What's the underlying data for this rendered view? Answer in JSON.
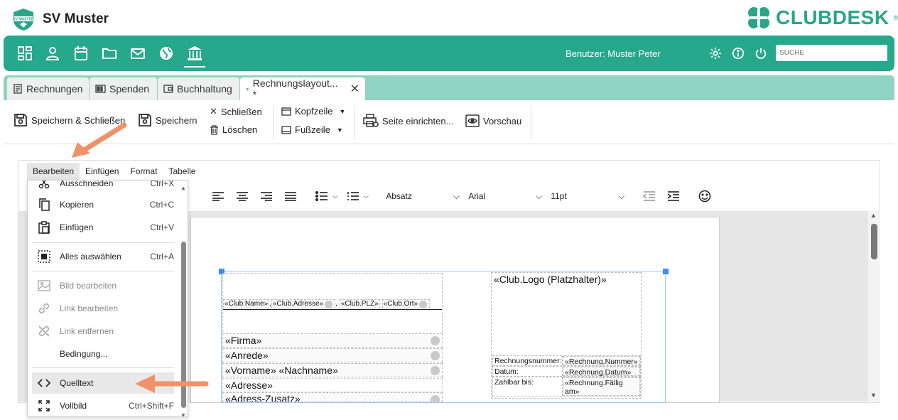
{
  "app": {
    "club_name": "SV Muster",
    "badge_text": "SV MUSTER",
    "brand": "CLUBDESK",
    "brand_mark": "®"
  },
  "nav": {
    "user_label": "Benutzer: Muster Peter",
    "search_placeholder": "SUCHE",
    "icons": [
      "dashboard-icon",
      "person-icon",
      "calendar-icon",
      "folder-icon",
      "mail-icon",
      "globe-icon",
      "bank-icon"
    ]
  },
  "tabs": [
    {
      "label": "Rechnungen",
      "icon": "invoice-icon"
    },
    {
      "label": "Spenden",
      "icon": "donation-icon"
    },
    {
      "label": "Buchhaltung",
      "icon": "ledger-icon"
    },
    {
      "label": "Rechnungslayout... *",
      "icon": "book-icon",
      "active": true
    }
  ],
  "toolbar": {
    "save_close": "Speichern & Schließen",
    "save": "Speichern",
    "close": "Schließen",
    "delete": "Löschen",
    "header": "Kopfzeile",
    "footer": "Fußzeile",
    "page_setup": "Seite einrichten...",
    "preview": "Vorschau"
  },
  "editor": {
    "menu": [
      "Bearbeiten",
      "Einfügen",
      "Format",
      "Tabelle"
    ],
    "block_format": "Absatz",
    "font": "Arial",
    "size": "11pt"
  },
  "document": {
    "sender_line": [
      "«Club.Name»",
      "«Club.Adresse»",
      "«Club.PLZ»",
      "«Club.Ort»"
    ],
    "address_fields": [
      "«Firma»",
      "«Anrede»",
      "«Vorname» «Nachname»",
      "«Adresse»",
      "«Adress-Zusatz»"
    ],
    "logo": "«Club.Logo (Platzhalter)»",
    "info_table": [
      {
        "label": "Rechnungsnummer:",
        "value": "«Rechnung.Nummer»"
      },
      {
        "label": "Datum:",
        "value": "«Rechnung.Datum»"
      },
      {
        "label": "Zahlbar bis:",
        "value": "«Rechnung.Fällig am»"
      }
    ]
  },
  "dropdown": {
    "items": [
      {
        "label": "Ausschneiden",
        "shortcut": "Ctrl+X",
        "icon": "scissors-icon",
        "disabled": false
      },
      {
        "label": "Kopieren",
        "shortcut": "Ctrl+C",
        "icon": "copy-icon",
        "disabled": false
      },
      {
        "label": "Einfügen",
        "shortcut": "Ctrl+V",
        "icon": "paste-icon",
        "disabled": false
      },
      {
        "label": "Alles auswählen",
        "shortcut": "Ctrl+A",
        "icon": "select-all-icon",
        "disabled": false
      },
      {
        "label": "Bild bearbeiten",
        "shortcut": "",
        "icon": "image-icon",
        "disabled": true
      },
      {
        "label": "Link bearbeiten",
        "shortcut": "",
        "icon": "link-icon",
        "disabled": true
      },
      {
        "label": "Link entfernen",
        "shortcut": "",
        "icon": "unlink-icon",
        "disabled": true
      },
      {
        "label": "Bedingung...",
        "shortcut": "",
        "icon": "",
        "disabled": false
      },
      {
        "label": "Quelltext",
        "shortcut": "",
        "icon": "code-icon",
        "disabled": false,
        "highlighted": true
      },
      {
        "label": "Vollbild",
        "shortcut": "Ctrl+Shift+F",
        "icon": "fullscreen-icon",
        "disabled": false
      }
    ]
  },
  "colors": {
    "brand_green": "#26a88c",
    "tab_strip": "#8fd4c3",
    "arrow": "#f0916a"
  }
}
